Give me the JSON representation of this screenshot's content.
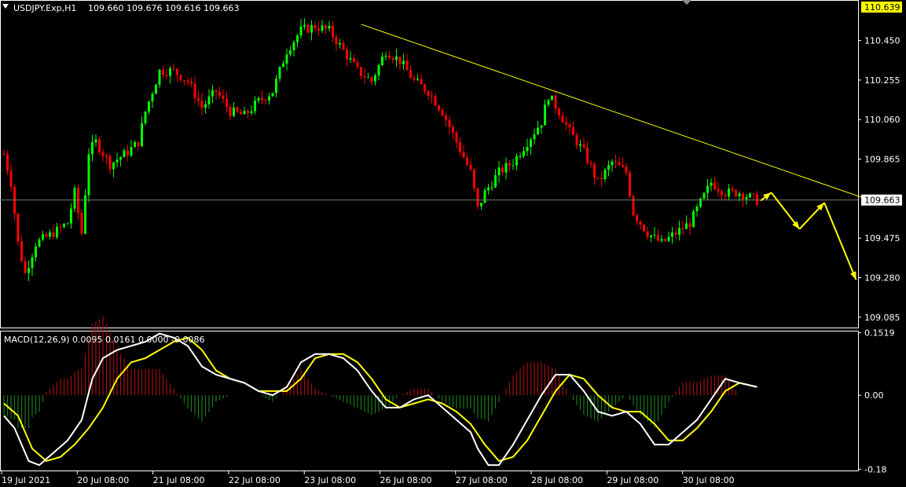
{
  "header": {
    "symbol": "USDJPY.Exp,H1",
    "ohlc": "109.660 109.676 109.616 109.663"
  },
  "macd_header": {
    "text": "MACD(12,26,9) 0.0095 0.0161 0.0000 -0.0086"
  },
  "colors": {
    "background": "#000000",
    "bull": "#00ff00",
    "bear": "#ff0000",
    "trendline": "#ffff00",
    "price_line": "#6f7f6f",
    "macd_main": "#ffffff",
    "macd_signal": "#ffff00",
    "hist_pos": "#a01010",
    "hist_neg": "#1a7a1a",
    "price_tag_bg": "#ffffff",
    "high_tag_bg": "#ffff00"
  },
  "price_axis": {
    "high_tag": "110.639",
    "current_tag": "109.663",
    "ticks": [
      "110.450",
      "110.255",
      "110.060",
      "109.865",
      "109.475",
      "109.280",
      "109.085"
    ]
  },
  "macd_axis": {
    "ticks": [
      "0.1519",
      "0.00",
      "-0.18"
    ]
  },
  "time_axis": {
    "labels": [
      "19 Jul 2021",
      "20 Jul 08:00",
      "21 Jul 08:00",
      "22 Jul 08:00",
      "23 Jul 08:00",
      "26 Jul 08:00",
      "27 Jul 08:00",
      "28 Jul 08:00",
      "29 Jul 08:00",
      "30 Jul 08:00"
    ]
  },
  "chart_data": {
    "type": "candlestick",
    "timeframe": "H1",
    "ylim": [
      109.03,
      110.65
    ],
    "price_line": 109.663,
    "price_keypoints": [
      [
        0,
        109.89
      ],
      [
        2,
        109.75
      ],
      [
        4,
        109.45
      ],
      [
        6,
        109.3
      ],
      [
        9,
        109.45
      ],
      [
        14,
        109.5
      ],
      [
        18,
        109.55
      ],
      [
        20,
        109.7
      ],
      [
        22,
        109.5
      ],
      [
        24,
        109.9
      ],
      [
        26,
        109.95
      ],
      [
        30,
        109.84
      ],
      [
        35,
        109.9
      ],
      [
        38,
        109.95
      ],
      [
        40,
        110.1
      ],
      [
        44,
        110.3
      ],
      [
        48,
        110.3
      ],
      [
        52,
        110.25
      ],
      [
        56,
        110.12
      ],
      [
        60,
        110.2
      ],
      [
        64,
        110.1
      ],
      [
        68,
        110.08
      ],
      [
        72,
        110.15
      ],
      [
        76,
        110.2
      ],
      [
        80,
        110.4
      ],
      [
        84,
        110.5
      ],
      [
        88,
        110.52
      ],
      [
        92,
        110.5
      ],
      [
        96,
        110.4
      ],
      [
        100,
        110.3
      ],
      [
        104,
        110.25
      ],
      [
        108,
        110.4
      ],
      [
        112,
        110.35
      ],
      [
        116,
        110.25
      ],
      [
        120,
        110.2
      ],
      [
        124,
        110.1
      ],
      [
        128,
        109.95
      ],
      [
        132,
        109.8
      ],
      [
        134,
        109.62
      ],
      [
        136,
        109.7
      ],
      [
        140,
        109.8
      ],
      [
        144,
        109.85
      ],
      [
        148,
        109.95
      ],
      [
        152,
        110.05
      ],
      [
        154,
        110.18
      ],
      [
        157,
        110.1
      ],
      [
        160,
        110.0
      ],
      [
        164,
        109.9
      ],
      [
        168,
        109.75
      ],
      [
        172,
        109.85
      ],
      [
        176,
        109.8
      ],
      [
        178,
        109.6
      ],
      [
        182,
        109.5
      ],
      [
        186,
        109.45
      ],
      [
        190,
        109.5
      ],
      [
        194,
        109.55
      ],
      [
        197,
        109.65
      ],
      [
        200,
        109.75
      ],
      [
        204,
        109.7
      ],
      [
        208,
        109.7
      ],
      [
        213,
        109.66
      ]
    ],
    "trendline": {
      "from": [
        101,
        110.53
      ],
      "to": [
        247,
        109.65
      ]
    },
    "forecast_arrows": [
      [
        214,
        109.66
      ],
      [
        217,
        109.7
      ],
      [
        225,
        109.52
      ],
      [
        232,
        109.65
      ],
      [
        241,
        109.27
      ]
    ],
    "macd": {
      "params": [
        12,
        26,
        9
      ],
      "values": [
        0.0095,
        0.0161,
        0.0,
        -0.0086
      ],
      "ylim": [
        -0.185,
        0.155
      ],
      "main_keypoints": [
        [
          0,
          -0.05
        ],
        [
          3,
          -0.08
        ],
        [
          7,
          -0.16
        ],
        [
          10,
          -0.17
        ],
        [
          14,
          -0.14
        ],
        [
          18,
          -0.11
        ],
        [
          22,
          -0.06
        ],
        [
          25,
          0.04
        ],
        [
          28,
          0.09
        ],
        [
          32,
          0.11
        ],
        [
          36,
          0.12
        ],
        [
          40,
          0.13
        ],
        [
          44,
          0.15
        ],
        [
          48,
          0.14
        ],
        [
          52,
          0.12
        ],
        [
          56,
          0.07
        ],
        [
          60,
          0.05
        ],
        [
          64,
          0.04
        ],
        [
          68,
          0.03
        ],
        [
          72,
          0.01
        ],
        [
          76,
          0.0
        ],
        [
          80,
          0.02
        ],
        [
          84,
          0.08
        ],
        [
          88,
          0.1
        ],
        [
          92,
          0.1
        ],
        [
          96,
          0.09
        ],
        [
          100,
          0.06
        ],
        [
          104,
          0.01
        ],
        [
          108,
          -0.03
        ],
        [
          112,
          -0.03
        ],
        [
          116,
          -0.01
        ],
        [
          120,
          0.0
        ],
        [
          124,
          -0.03
        ],
        [
          128,
          -0.06
        ],
        [
          132,
          -0.09
        ],
        [
          134,
          -0.13
        ],
        [
          137,
          -0.17
        ],
        [
          140,
          -0.17
        ],
        [
          144,
          -0.12
        ],
        [
          148,
          -0.06
        ],
        [
          152,
          0.0
        ],
        [
          156,
          0.05
        ],
        [
          160,
          0.05
        ],
        [
          164,
          0.01
        ],
        [
          168,
          -0.04
        ],
        [
          172,
          -0.05
        ],
        [
          176,
          -0.04
        ],
        [
          180,
          -0.07
        ],
        [
          184,
          -0.12
        ],
        [
          188,
          -0.12
        ],
        [
          192,
          -0.09
        ],
        [
          196,
          -0.06
        ],
        [
          200,
          -0.01
        ],
        [
          204,
          0.04
        ],
        [
          208,
          0.03
        ],
        [
          213,
          0.02
        ]
      ],
      "signal_keypoints": [
        [
          0,
          -0.02
        ],
        [
          4,
          -0.05
        ],
        [
          8,
          -0.13
        ],
        [
          12,
          -0.16
        ],
        [
          16,
          -0.15
        ],
        [
          20,
          -0.12
        ],
        [
          24,
          -0.08
        ],
        [
          28,
          -0.03
        ],
        [
          32,
          0.04
        ],
        [
          36,
          0.08
        ],
        [
          40,
          0.09
        ],
        [
          44,
          0.11
        ],
        [
          48,
          0.13
        ],
        [
          52,
          0.14
        ],
        [
          56,
          0.11
        ],
        [
          60,
          0.06
        ],
        [
          64,
          0.04
        ],
        [
          68,
          0.03
        ],
        [
          72,
          0.01
        ],
        [
          76,
          0.01
        ],
        [
          80,
          0.01
        ],
        [
          84,
          0.04
        ],
        [
          88,
          0.09
        ],
        [
          92,
          0.1
        ],
        [
          96,
          0.1
        ],
        [
          100,
          0.08
        ],
        [
          104,
          0.04
        ],
        [
          108,
          -0.01
        ],
        [
          112,
          -0.03
        ],
        [
          116,
          -0.02
        ],
        [
          120,
          -0.01
        ],
        [
          124,
          -0.02
        ],
        [
          128,
          -0.04
        ],
        [
          132,
          -0.07
        ],
        [
          136,
          -0.12
        ],
        [
          140,
          -0.16
        ],
        [
          144,
          -0.15
        ],
        [
          148,
          -0.11
        ],
        [
          152,
          -0.05
        ],
        [
          156,
          0.01
        ],
        [
          160,
          0.05
        ],
        [
          164,
          0.04
        ],
        [
          168,
          0.0
        ],
        [
          172,
          -0.03
        ],
        [
          176,
          -0.04
        ],
        [
          180,
          -0.04
        ],
        [
          184,
          -0.07
        ],
        [
          188,
          -0.11
        ],
        [
          192,
          -0.11
        ],
        [
          196,
          -0.08
        ],
        [
          200,
          -0.04
        ],
        [
          204,
          0.01
        ],
        [
          208,
          0.03
        ],
        [
          213,
          0.02
        ]
      ]
    }
  }
}
